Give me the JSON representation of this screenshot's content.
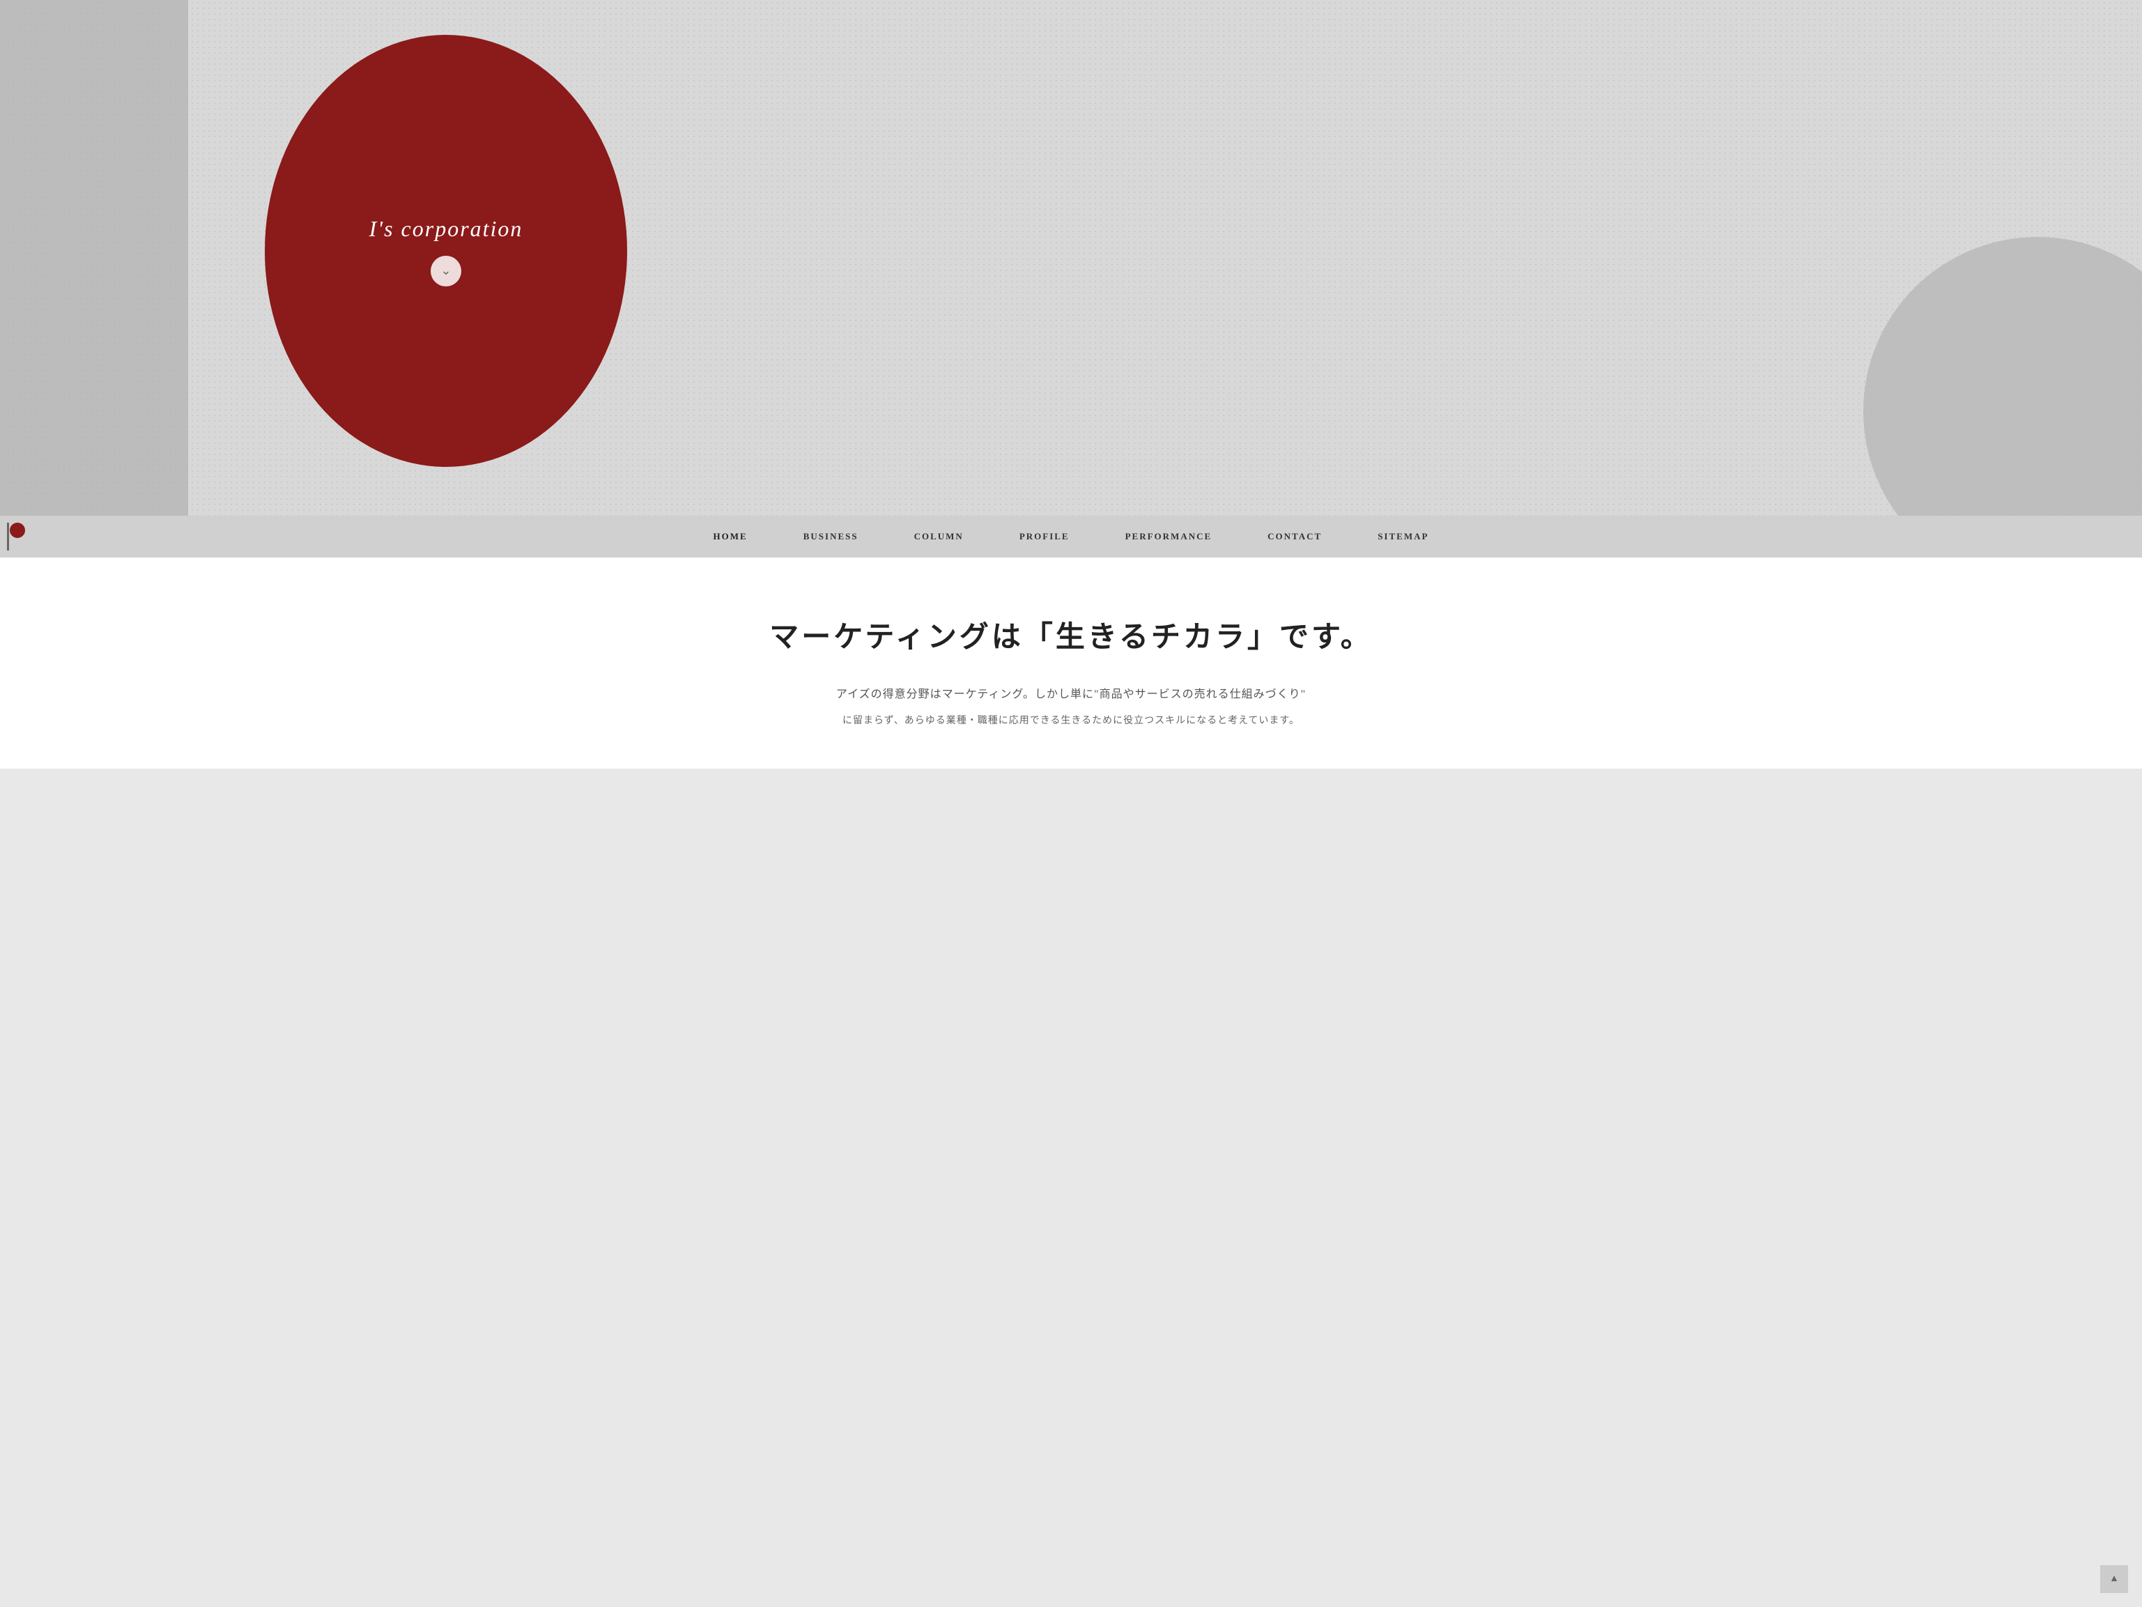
{
  "hero": {
    "title": "I's corporation",
    "scroll_button": "❯"
  },
  "navbar": {
    "items": [
      {
        "label": "HOME",
        "active": true
      },
      {
        "label": "BUSINESS",
        "active": false
      },
      {
        "label": "COLUMN",
        "active": false
      },
      {
        "label": "PROFILE",
        "active": false
      },
      {
        "label": "PERFORMANCE",
        "active": false
      },
      {
        "label": "CONTACT",
        "active": false
      },
      {
        "label": "SITEMAP",
        "active": false
      }
    ]
  },
  "content": {
    "main_title": "マーケティングは「生きるチカラ」です。",
    "subtitle": "アイズの得意分野はマーケティング。しかし単に\"商品やサービスの売れる仕組みづくり\"",
    "desc": "に留まらず、あらゆる業種・職種に応用できる生きるために役立つスキルになると考えています。"
  },
  "colors": {
    "red_circle": "#8b1a1a",
    "nav_bg": "#d0d0d0",
    "hero_bg": "#d8d8d8",
    "left_block": "#b0b0b0"
  }
}
